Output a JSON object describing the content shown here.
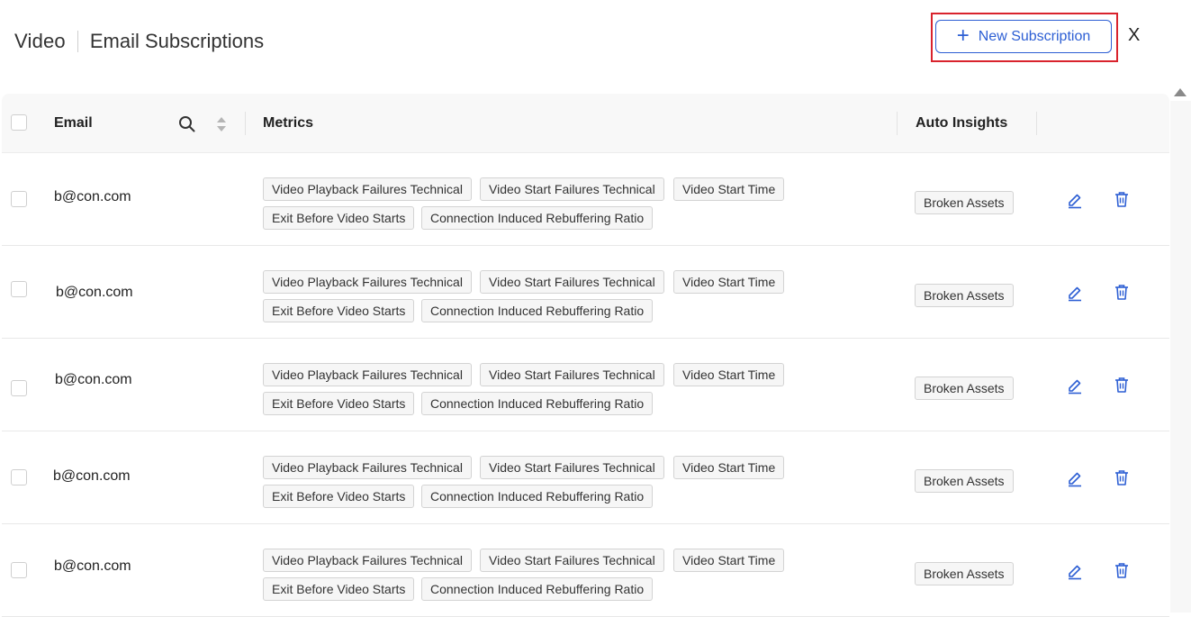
{
  "header": {
    "section": "Video",
    "title": "Email Subscriptions",
    "new_button": "New Subscription",
    "close": "X"
  },
  "columns": {
    "email": "Email",
    "metrics": "Metrics",
    "auto_insights": "Auto Insights"
  },
  "rows": [
    {
      "email": "b@con.com",
      "metrics": [
        "Video Playback Failures Technical",
        "Video Start Failures Technical",
        "Video Start Time",
        "Exit Before Video Starts",
        "Connection Induced Rebuffering Ratio"
      ],
      "insight": "Broken Assets"
    },
    {
      "email": "b@con.com",
      "metrics": [
        "Video Playback Failures Technical",
        "Video Start Failures Technical",
        "Video Start Time",
        "Exit Before Video Starts",
        "Connection Induced Rebuffering Ratio"
      ],
      "insight": "Broken Assets"
    },
    {
      "email": "b@con.com",
      "metrics": [
        "Video Playback Failures Technical",
        "Video Start Failures Technical",
        "Video Start Time",
        "Exit Before Video Starts",
        "Connection Induced Rebuffering Ratio"
      ],
      "insight": "Broken Assets"
    },
    {
      "email": "b@con.com",
      "metrics": [
        "Video Playback Failures Technical",
        "Video Start Failures Technical",
        "Video Start Time",
        "Exit Before Video Starts",
        "Connection Induced Rebuffering Ratio"
      ],
      "insight": "Broken Assets"
    },
    {
      "email": "b@con.com",
      "metrics": [
        "Video Playback Failures Technical",
        "Video Start Failures Technical",
        "Video Start Time",
        "Exit Before Video Starts",
        "Connection Induced Rebuffering Ratio"
      ],
      "insight": "Broken Assets"
    }
  ],
  "colors": {
    "accent": "#2d5fd4",
    "highlight": "#d9232d"
  }
}
